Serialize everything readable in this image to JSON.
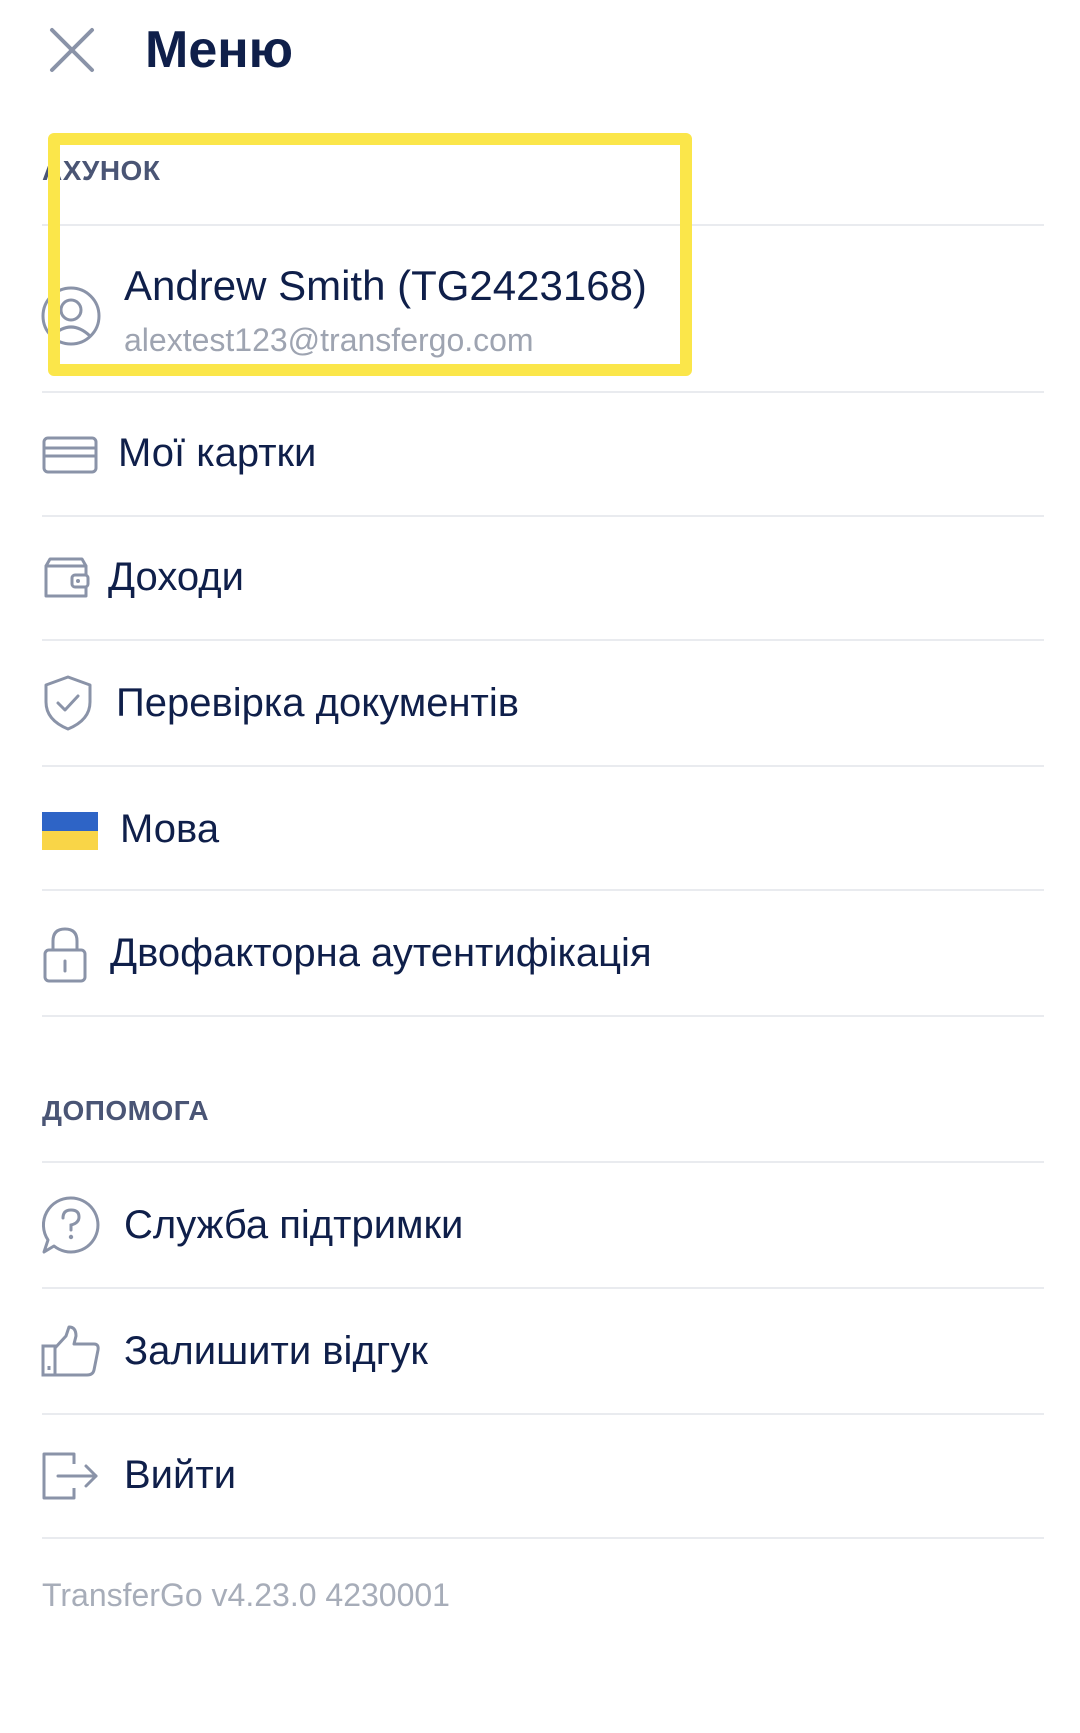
{
  "header": {
    "title": "Меню",
    "close_icon": "close-icon"
  },
  "account_section": {
    "title": "АХУНОК",
    "profile": {
      "icon": "user-icon",
      "name": "Andrew Smith (TG2423168)",
      "email": "alextest123@transfergo.com"
    },
    "items": [
      {
        "icon": "card-icon",
        "label": "Мої картки"
      },
      {
        "icon": "wallet-icon",
        "label": "Доходи"
      },
      {
        "icon": "shield-check-icon",
        "label": "Перевірка документів"
      },
      {
        "icon": "ukraine-flag-icon",
        "label": "Мова"
      },
      {
        "icon": "lock-icon",
        "label": "Двофакторна аутентифікація"
      }
    ]
  },
  "help_section": {
    "title": "ДОПОМОГА",
    "items": [
      {
        "icon": "question-icon",
        "label": "Служба підтримки"
      },
      {
        "icon": "thumbs-up-icon",
        "label": "Залишити відгук"
      },
      {
        "icon": "logout-icon",
        "label": "Вийти"
      }
    ]
  },
  "footer": {
    "version": "TransferGo v4.23.0 4230001"
  },
  "colors": {
    "text": "#0f1f4a",
    "muted": "#9ea4b1",
    "icon": "#8a93a8",
    "highlight": "#fbe64a",
    "flag_blue": "#2e64c6",
    "flag_yellow": "#f9d547"
  }
}
